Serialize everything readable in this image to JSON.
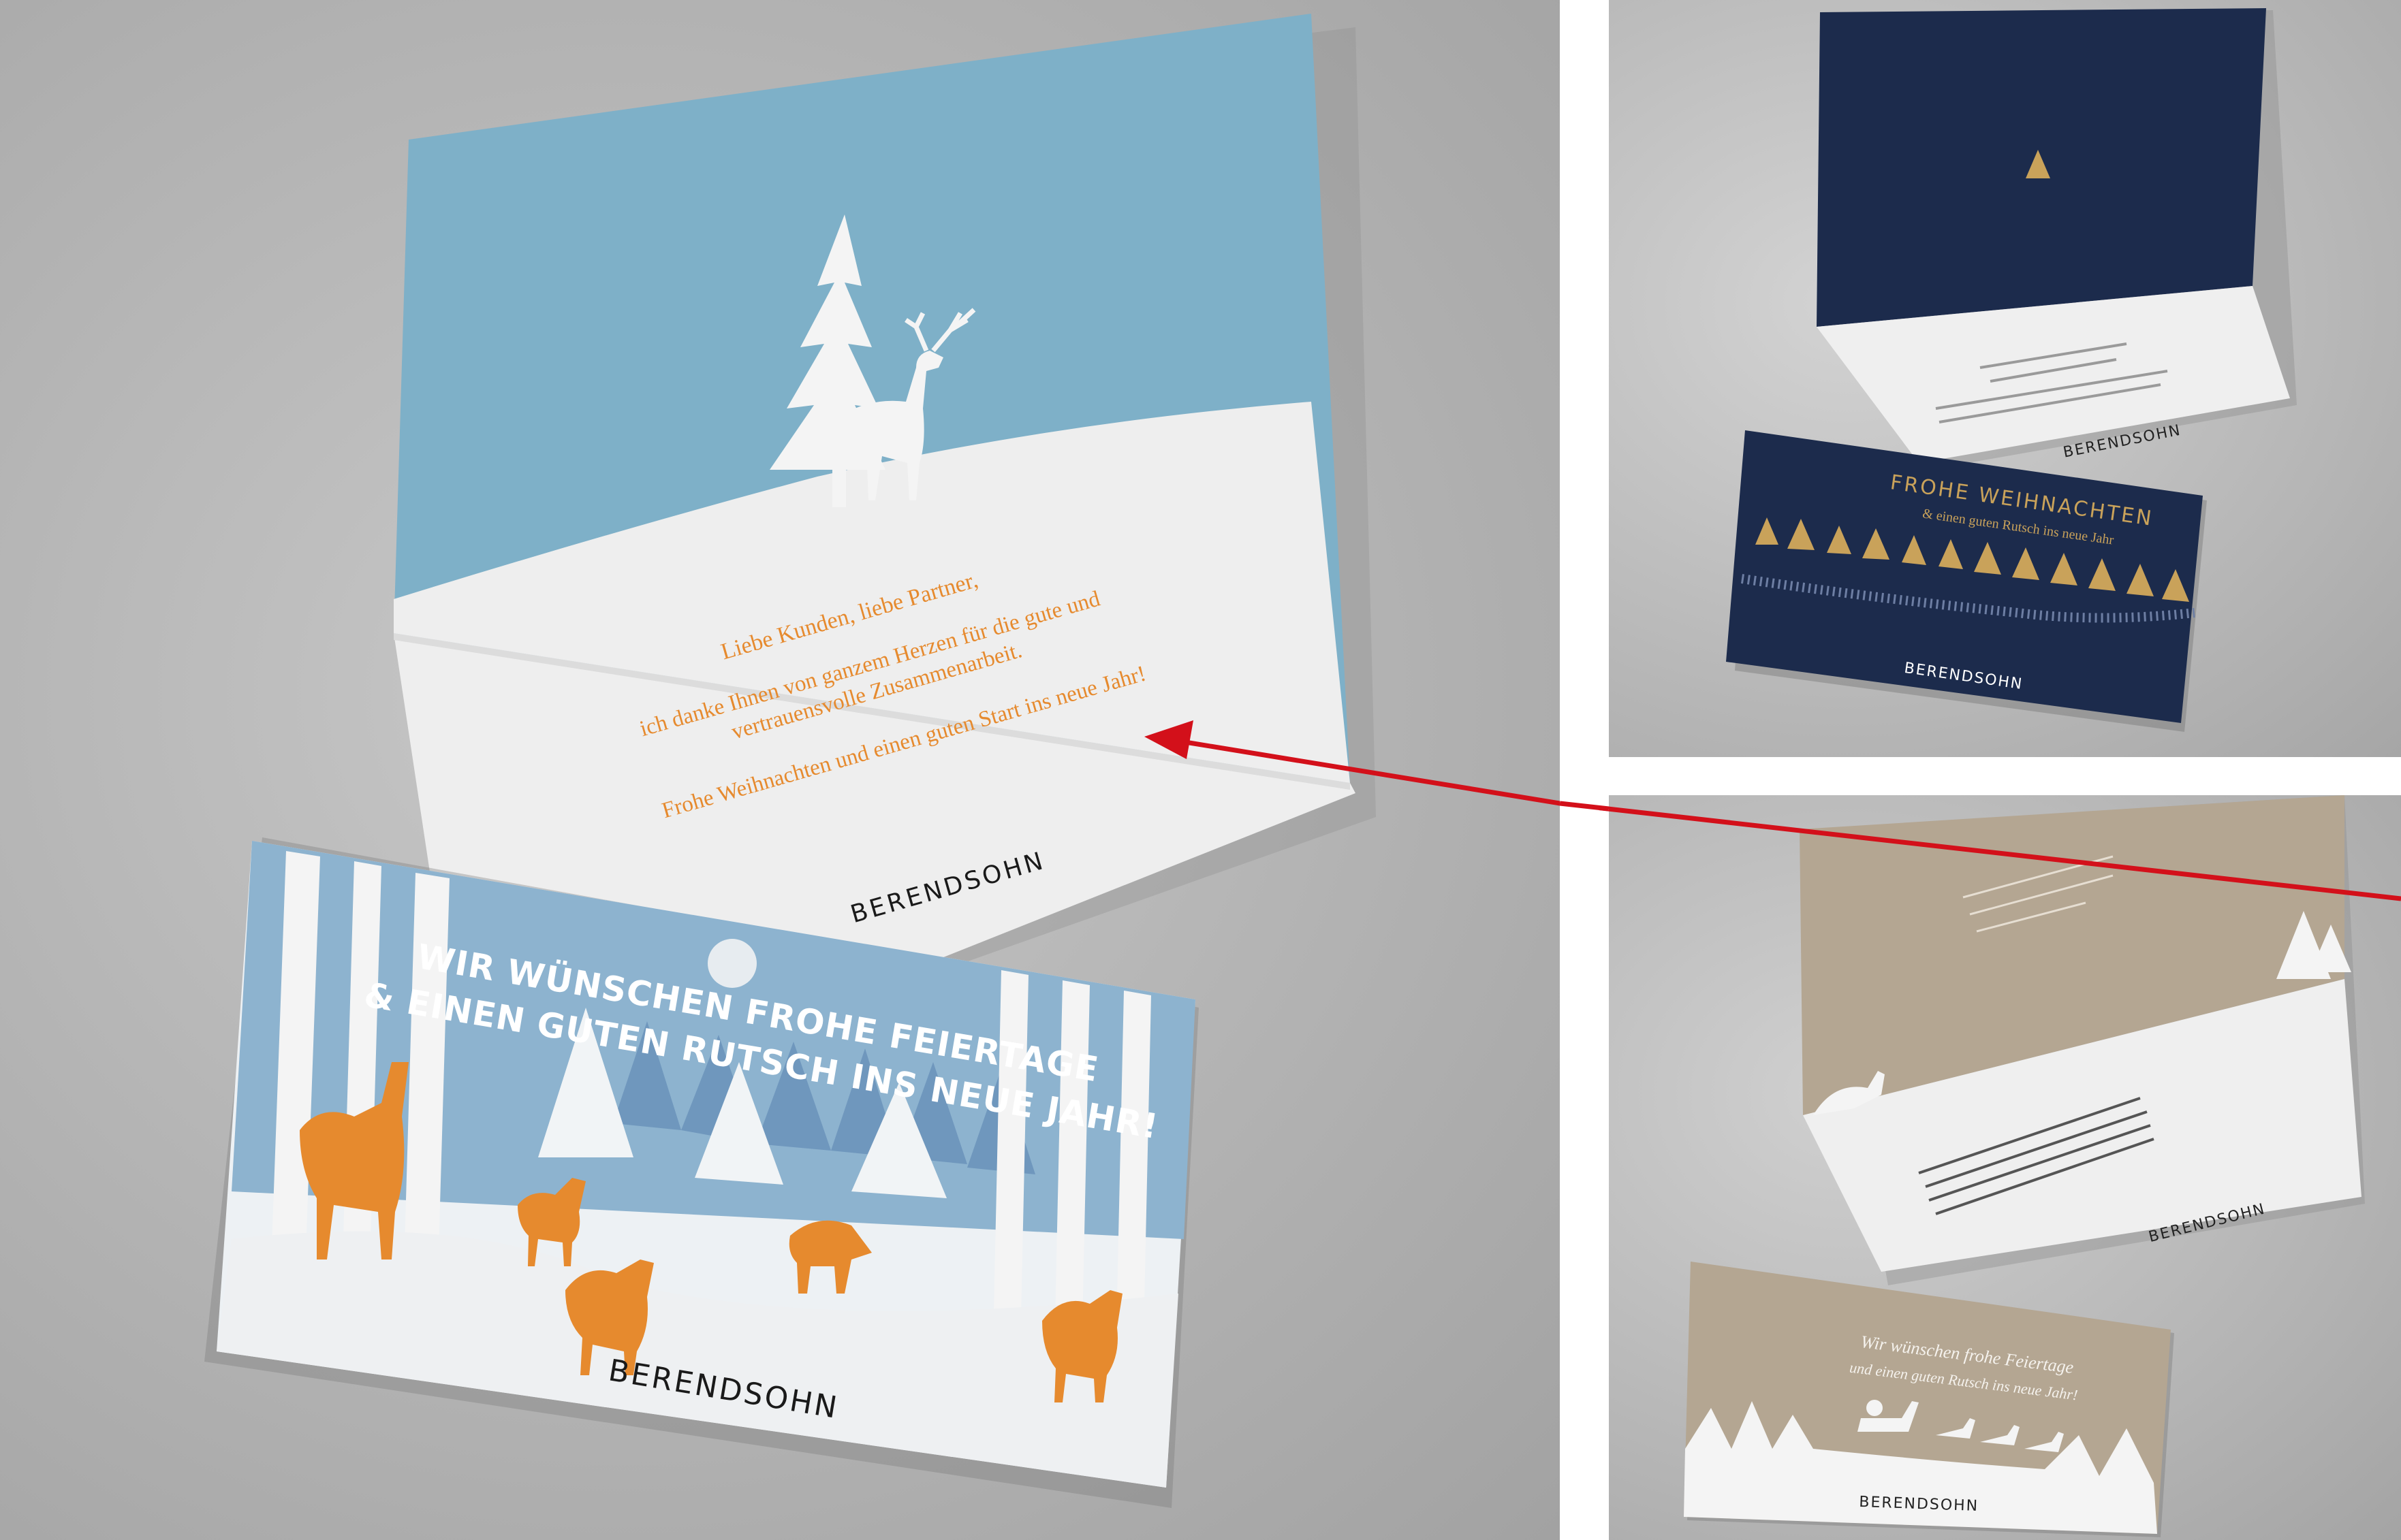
{
  "main_card": {
    "greeting": "Liebe Kunden, liebe Partner,",
    "body_line_1": "ich danke Ihnen von ganzem Herzen für die gute und",
    "body_line_2": "vertrauensvolle Zusammenarbeit.",
    "closing": "Frohe Weihnachten und einen guten Start ins neue Jahr!",
    "brand": "BERENDSOHN"
  },
  "cover_card": {
    "headline_1": "WIR WÜNSCHEN FROHE FEIERTAGE",
    "headline_2": "& EINEN GUTEN RUTSCH INS NEUE JAHR!",
    "brand": "BERENDSOHN"
  },
  "navy_inner_card": {
    "brand": "BERENDSOHN"
  },
  "navy_cover_card": {
    "title": "FROHE WEIHNACHTEN",
    "subtitle": "& einen guten Rutsch ins neue Jahr",
    "brand": "BERENDSOHN"
  },
  "beige_inner_card": {
    "brand": "BERENDSOHN"
  },
  "beige_cover_card": {
    "line_1": "Wir wünschen frohe Feiertage",
    "line_2": "und einen guten Rutsch ins neue Jahr!",
    "brand": "BERENDSOHN"
  },
  "colors": {
    "sky_blue": "#7eb0c8",
    "orange": "#e68a2e",
    "navy": "#1c2b4c",
    "gold": "#c9a25a",
    "beige": "#b4a692",
    "arrow_red": "#d3101a"
  }
}
